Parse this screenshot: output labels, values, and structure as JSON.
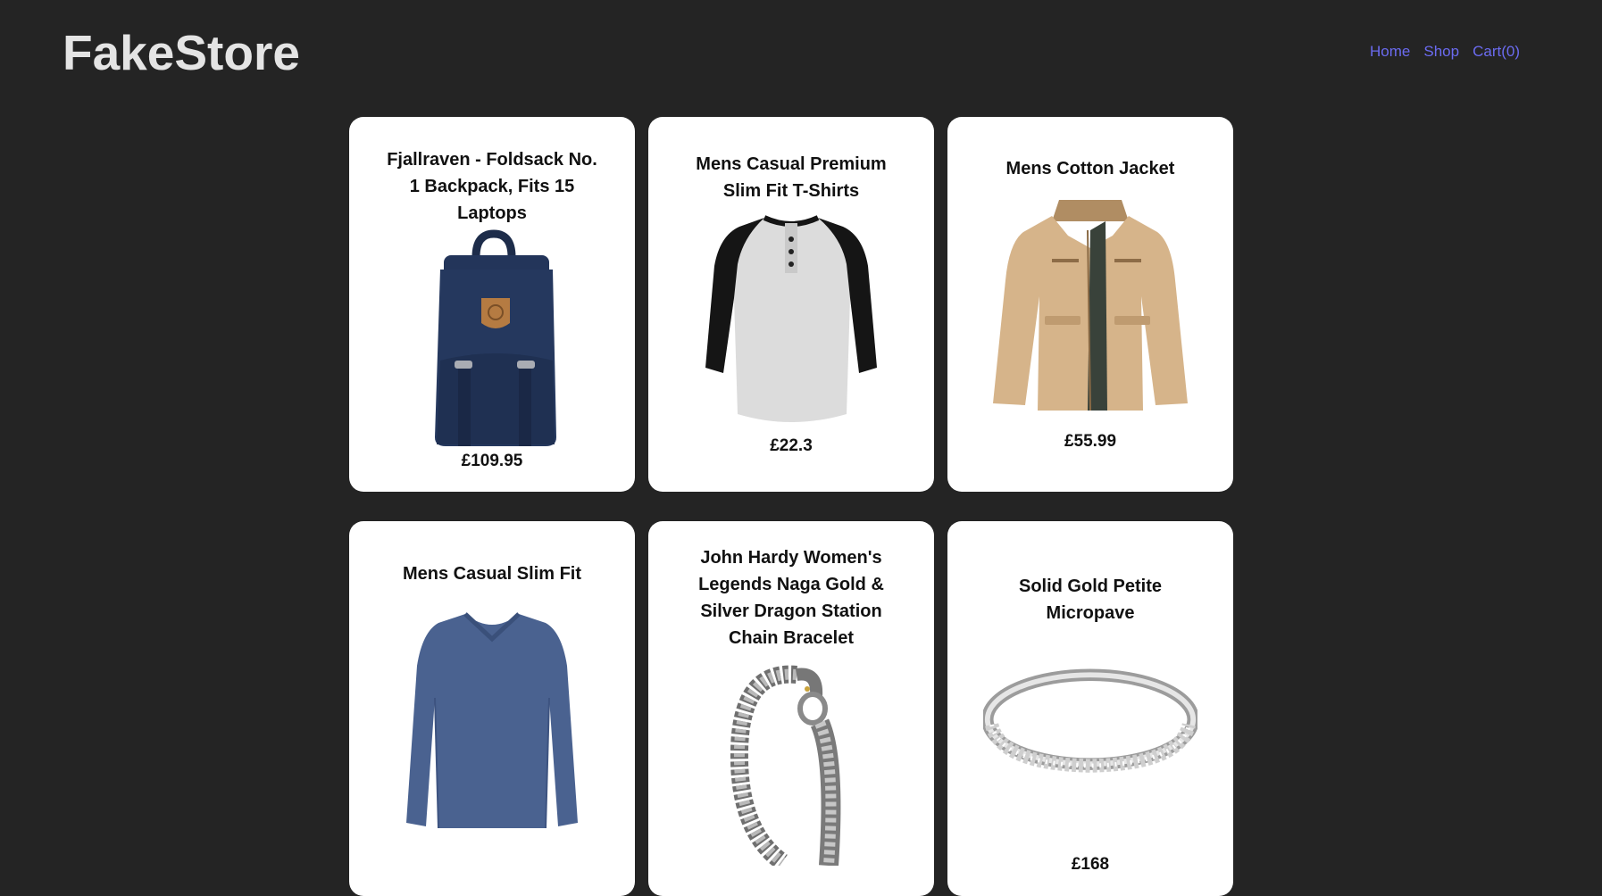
{
  "header": {
    "logo": "FakeStore",
    "nav": [
      "Home",
      "Shop",
      "Cart(0)"
    ],
    "nav_color": "#6b6bf0"
  },
  "page": {
    "background": "#242424",
    "card_background": "#ffffff"
  },
  "products": [
    {
      "title": "Fjallraven - Foldsack No. 1 Backpack, Fits 15 Laptops",
      "price": "£109.95",
      "image": "navy-backpack"
    },
    {
      "title": "Mens Casual Premium Slim Fit T-Shirts",
      "price": "£22.3",
      "image": "raglan-henley-tshirt"
    },
    {
      "title": "Mens Cotton Jacket",
      "price": "£55.99",
      "image": "khaki-cotton-jacket"
    },
    {
      "title": "Mens Casual Slim Fit",
      "price": "",
      "image": "blue-longsleeve-shirt"
    },
    {
      "title": "John Hardy Women's Legends Naga Gold & Silver Dragon Station Chain Bracelet",
      "price": "",
      "image": "silver-dragon-bracelet"
    },
    {
      "title": "Solid Gold Petite Micropave",
      "price": "£168",
      "image": "silver-micropave-ring"
    }
  ]
}
